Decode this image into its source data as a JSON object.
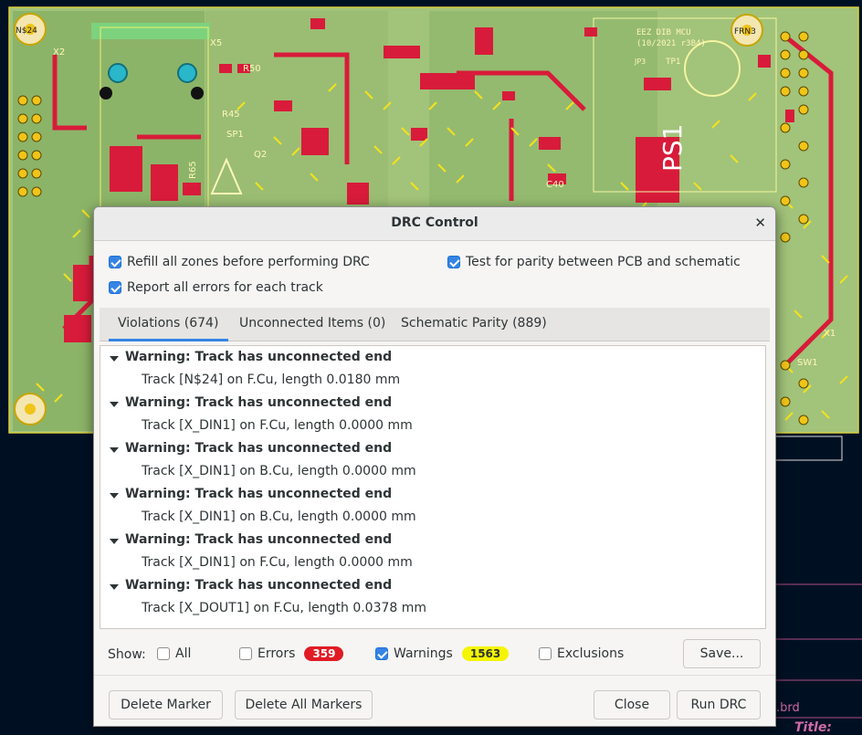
{
  "dialog": {
    "title": "DRC Control",
    "close_glyph": "✕",
    "options": {
      "refill": "Refill all zones before performing DRC",
      "parity": "Test for parity between PCB and schematic",
      "report_all": "Report all errors for each track"
    },
    "tabs": [
      "Violations (674)",
      "Unconnected Items (0)",
      "Schematic Parity (889)"
    ],
    "violations": [
      {
        "title": "Warning: Track has unconnected end",
        "detail": "Track [N$24] on F.Cu, length 0.0180 mm"
      },
      {
        "title": "Warning: Track has unconnected end",
        "detail": "Track [X_DIN1] on F.Cu, length 0.0000 mm"
      },
      {
        "title": "Warning: Track has unconnected end",
        "detail": "Track [X_DIN1] on B.Cu, length 0.0000 mm"
      },
      {
        "title": "Warning: Track has unconnected end",
        "detail": "Track [X_DIN1] on B.Cu, length 0.0000 mm"
      },
      {
        "title": "Warning: Track has unconnected end",
        "detail": "Track [X_DIN1] on F.Cu, length 0.0000 mm"
      },
      {
        "title": "Warning: Track has unconnected end",
        "detail": "Track [X_DOUT1] on F.Cu, length 0.0378 mm"
      }
    ],
    "filter": {
      "show_label": "Show:",
      "all": "All",
      "errors": "Errors",
      "errors_count": "359",
      "warnings": "Warnings",
      "warnings_count": "1563",
      "exclusions": "Exclusions",
      "save": "Save..."
    },
    "buttons": {
      "delete_marker": "Delete Marker",
      "delete_all": "Delete All Markers",
      "close": "Close",
      "run": "Run DRC"
    }
  },
  "board": {
    "labels": [
      "N$24",
      "FRN3",
      "X2",
      "X5",
      "R50",
      "R45",
      "SP1",
      "Q2",
      "R65",
      "C40",
      "PS1",
      "EEZ DIB MCU",
      "(10/2021 r3B4)",
      "TP1",
      "JP3",
      "X1",
      "SW1",
      ".brd",
      "Title:"
    ],
    "errors_color": "#e01b24",
    "warnings_color": "#f5f500",
    "accent": "#3584e4"
  }
}
